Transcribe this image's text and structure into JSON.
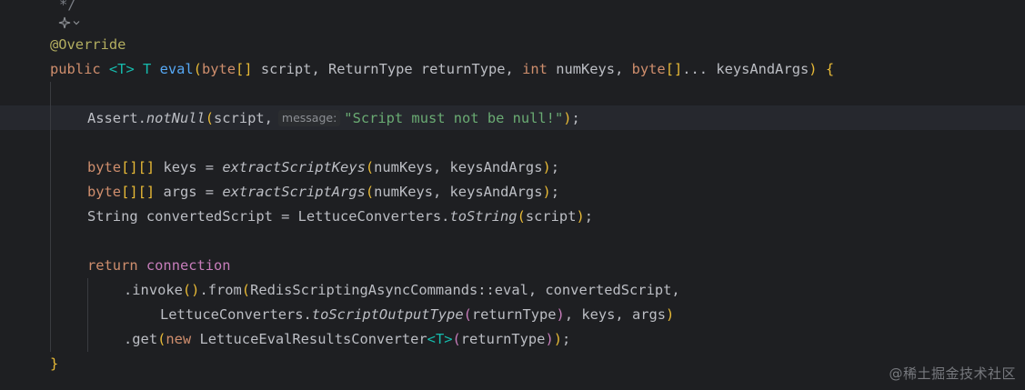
{
  "editor": {
    "colors": {
      "background": "#1e1f22",
      "current_line": "#26282e",
      "keyword": "#cf8e6d",
      "annotation": "#b3ae60",
      "type_param": "#16baac",
      "method": "#56a8f5",
      "string": "#6aab73",
      "field": "#c77dbb",
      "comment": "#7a7e85",
      "default": "#bcbec4"
    },
    "icons": {
      "fold_marker": "ai-sparkle-icon",
      "fold_chevron": "chevron-down-icon"
    },
    "lines": {
      "comment_end": "*/",
      "annotation": "@Override",
      "l2": {
        "kw_public": "public",
        "lt": "<",
        "tparam": "T",
        "gt": ">",
        "ret": "T",
        "method": "eval",
        "open": "(",
        "kw_byte": "byte",
        "brackets": "[]",
        "rest1": "script, ReturnType returnType,",
        "kw_int": "int",
        "rest2": "numKeys,",
        "kw_byte2": "byte",
        "brackets2": "[]",
        "rest3": "... keysAndArgs",
        "close": ")",
        "brace": "{"
      },
      "l4": {
        "cls": "Assert.",
        "method": "notNull",
        "open": "(",
        "arg": "script,",
        "hint": "message:",
        "string": "\"Script must not be null!\"",
        "close": ")",
        "semi": ";"
      },
      "l6": {
        "kw": "byte",
        "brackets": "[][]",
        "decl": "keys =",
        "method": "extractScriptKeys",
        "open": "(",
        "args": "numKeys, keysAndArgs",
        "close": ")",
        "semi": ";"
      },
      "l7": {
        "kw": "byte",
        "brackets": "[][]",
        "decl": "args =",
        "method": "extractScriptArgs",
        "open": "(",
        "args": "numKeys, keysAndArgs",
        "close": ")",
        "semi": ";"
      },
      "l8": {
        "decl": "String convertedScript = LettuceConverters.",
        "method": "toString",
        "open": "(",
        "args": "script",
        "close": ")",
        "semi": ";"
      },
      "l10": {
        "kw": "return",
        "field": "connection"
      },
      "l11": {
        "dot1": ".",
        "m1": "invoke",
        "p1": "()",
        "dot2": ".",
        "m2": "from",
        "open": "(",
        "args": "RedisScriptingAsyncCommands::eval, convertedScript,"
      },
      "l12": {
        "cls": "LettuceConverters.",
        "method": "toScriptOutputType",
        "open": "(",
        "arg": "returnType",
        "close": ")",
        "rest": ", keys, args",
        "close2": ")"
      },
      "l13": {
        "dot": ".",
        "m": "get",
        "open": "(",
        "kw_new": "new",
        "cls": "LettuceEvalResultsConverter",
        "lt": "<",
        "tparam": "T",
        "gt": ">",
        "open2": "(",
        "arg": "returnType",
        "close2": ")",
        "close": ")",
        "semi": ";"
      },
      "closing_brace": "}"
    }
  },
  "watermark": "@稀土掘金技术社区"
}
